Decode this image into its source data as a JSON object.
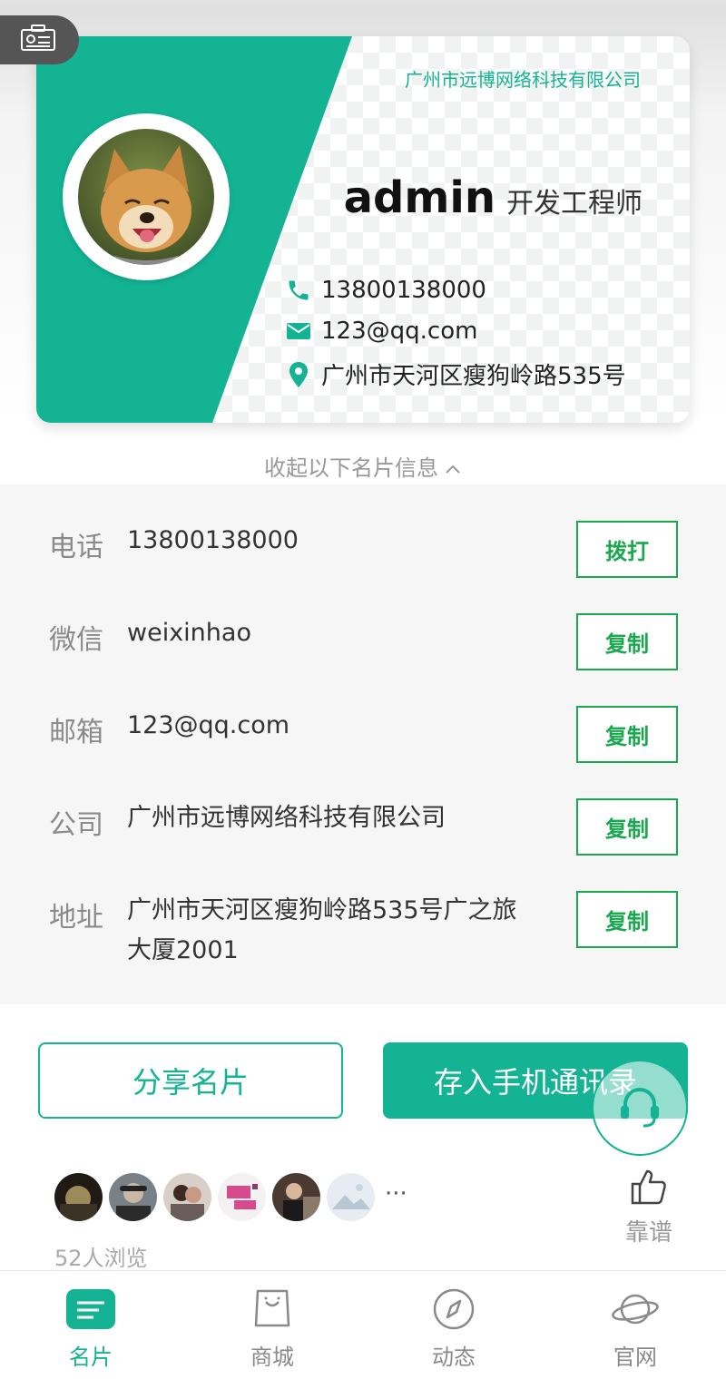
{
  "card": {
    "company": "广州市远博网络科技有限公司",
    "name": "admin",
    "title": "开发工程师",
    "phone": "13800138000",
    "email": "123@qq.com",
    "address": "广州市天河区瘦狗岭路535号"
  },
  "collapse_toggle": {
    "label": "收起以下名片信息",
    "icon": "chevron-up-icon"
  },
  "info_rows": [
    {
      "label": "电话",
      "value": "13800138000",
      "button": "拨打"
    },
    {
      "label": "微信",
      "value": "weixinhao",
      "button": "复制"
    },
    {
      "label": "邮箱",
      "value": "123@qq.com",
      "button": "复制"
    },
    {
      "label": "公司",
      "value": "广州市远博网络科技有限公司",
      "button": "复制"
    },
    {
      "label": "地址",
      "value": "广州市天河区瘦狗岭路535号广之旅大厦2001",
      "button": "复制"
    }
  ],
  "actions": {
    "share": "分享名片",
    "save": "存入手机通讯录"
  },
  "viewers": {
    "count_text": "52人浏览",
    "more": "···"
  },
  "like": {
    "label": "靠谱",
    "icon": "thumbs-up-icon"
  },
  "tabs": [
    {
      "label": "名片",
      "icon": "card-icon",
      "active": true
    },
    {
      "label": "商城",
      "icon": "shopping-bag-icon",
      "active": false
    },
    {
      "label": "动态",
      "icon": "compass-icon",
      "active": false
    },
    {
      "label": "官网",
      "icon": "planet-icon",
      "active": false
    }
  ],
  "colors": {
    "accent": "#13b394",
    "button_green": "#1aa84e",
    "panel_bg": "#f6f6f6"
  }
}
